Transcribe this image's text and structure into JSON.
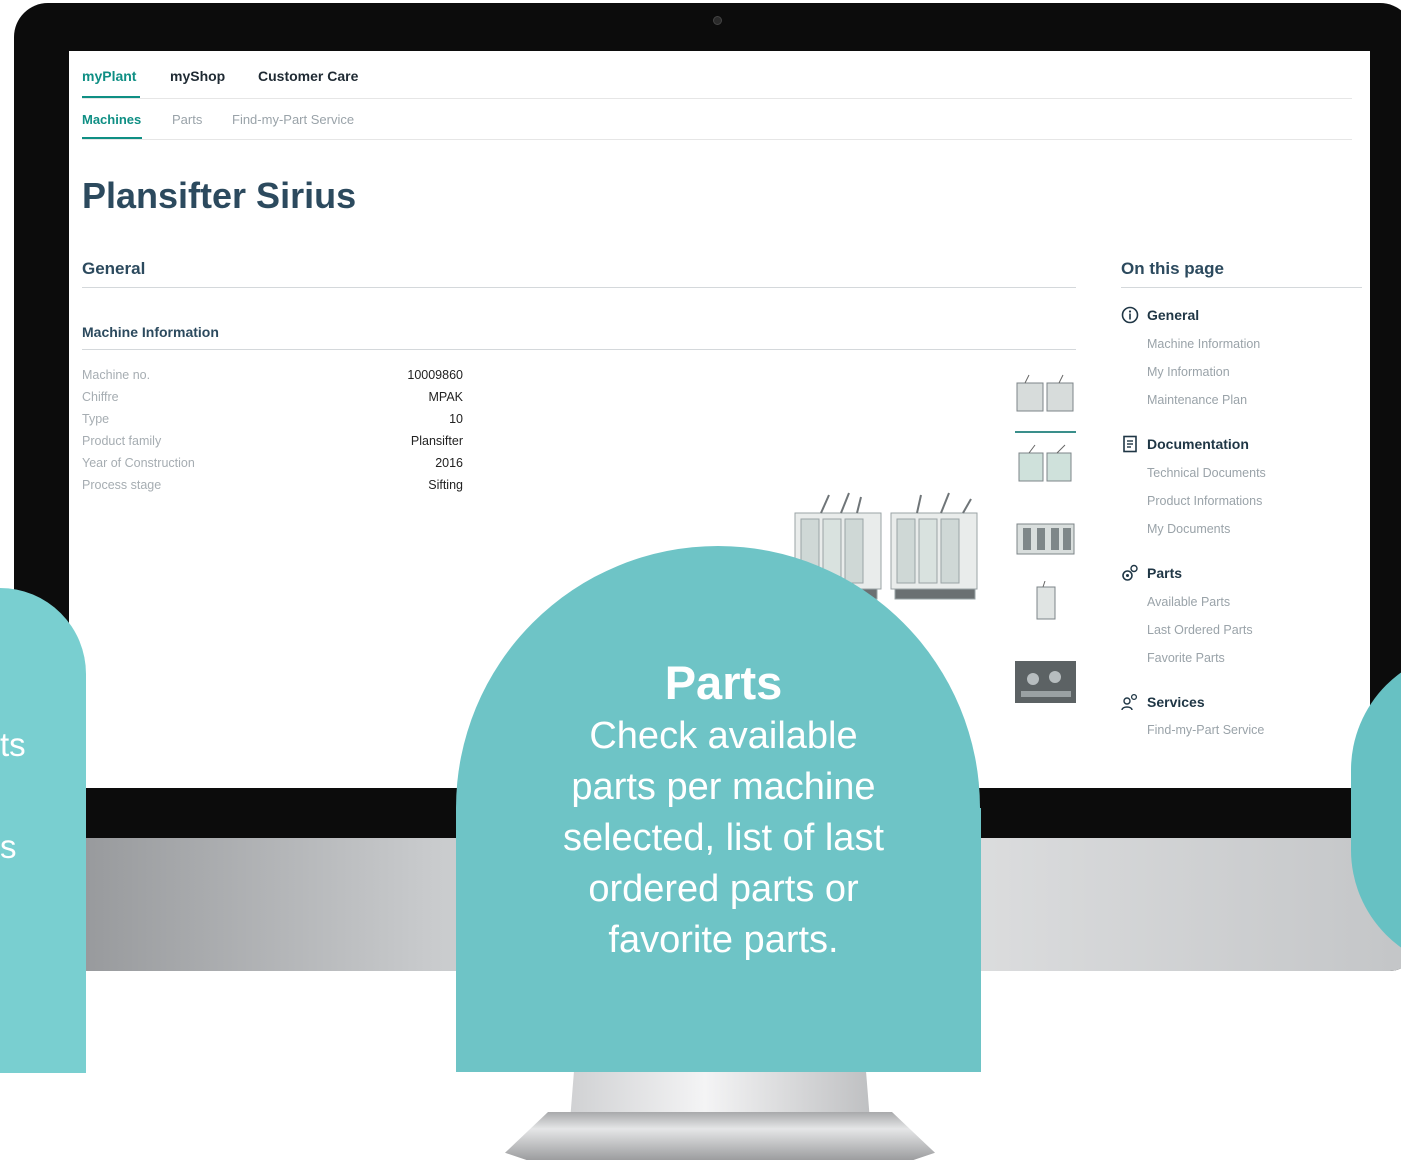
{
  "top_nav": [
    "myPlant",
    "myShop",
    "Customer Care"
  ],
  "sub_nav": [
    "Machines",
    "Parts",
    "Find-my-Part Service"
  ],
  "page_title": "Plansifter Sirius",
  "general": {
    "title": "General",
    "machine_info_title": "Machine Information",
    "rows": [
      {
        "label": "Machine no.",
        "value": "10009860"
      },
      {
        "label": "Chiffre",
        "value": "MPAK"
      },
      {
        "label": "Type",
        "value": "10"
      },
      {
        "label": "Product family",
        "value": "Plansifter"
      },
      {
        "label": "Year of Construction",
        "value": "2016"
      },
      {
        "label": "Process stage",
        "value": "Sifting"
      }
    ]
  },
  "on_this_page": {
    "title": "On this page",
    "sections": [
      {
        "label": "General",
        "icon": "info-icon",
        "links": [
          "Machine Information",
          "My Information",
          "Maintenance Plan"
        ]
      },
      {
        "label": "Documentation",
        "icon": "document-icon",
        "links": [
          "Technical Documents",
          "Product Informations",
          "My Documents"
        ]
      },
      {
        "label": "Parts",
        "icon": "gears-icon",
        "links": [
          "Available Parts",
          "Last Ordered Parts",
          "Favorite Parts"
        ]
      },
      {
        "label": "Services",
        "icon": "people-icon",
        "links": [
          "Find-my-Part Service"
        ]
      }
    ]
  },
  "overlay": {
    "heading": "Parts",
    "body": [
      "Check available",
      "parts per machine",
      "selected, list of last",
      "ordered parts or",
      "favorite parts."
    ],
    "left_fragments": [
      "ts",
      "s"
    ]
  },
  "colors": {
    "accent": "#0f8f84",
    "title": "#2c4a5e",
    "bubble": "#6ec4c6"
  }
}
